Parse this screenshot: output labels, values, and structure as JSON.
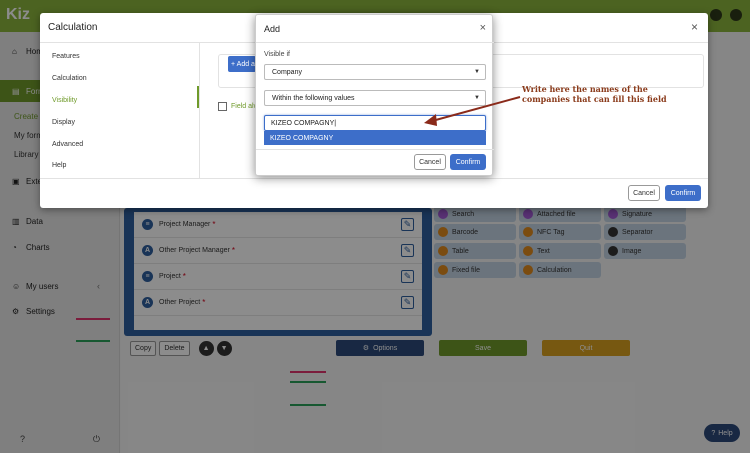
{
  "app": {
    "brand_color": "#8bb43c",
    "accent_blue": "#3d6ec9"
  },
  "sidebar": {
    "home_label": "Home",
    "forms_label": "Forms",
    "sub_items": [
      "Create a",
      "My forms",
      "Library"
    ],
    "external_label": "Exte",
    "data_label": "Data",
    "charts_label": "Charts",
    "users_label": "My users",
    "settings_label": "Settings"
  },
  "background_fields": {
    "rows": [
      {
        "icon": "≡",
        "label": "Project Manager",
        "required": "*"
      },
      {
        "icon": "A",
        "label": "Other Project Manager",
        "required": "*"
      },
      {
        "icon": "≡",
        "label": "Project",
        "required": "*"
      },
      {
        "icon": "A",
        "label": "Other Project",
        "required": "*"
      }
    ]
  },
  "palette": {
    "items": [
      {
        "label": "Search",
        "color": "#a35ad6"
      },
      {
        "label": "Attached file",
        "color": "#a35ad6"
      },
      {
        "label": "Signature",
        "color": "#a35ad6"
      },
      {
        "label": "Barcode",
        "color": "#e08a1e"
      },
      {
        "label": "NFC Tag",
        "color": "#e08a1e"
      },
      {
        "label": "Separator",
        "color": "#333333"
      },
      {
        "label": "Table",
        "color": "#e08a1e"
      },
      {
        "label": "Text",
        "color": "#e08a1e"
      },
      {
        "label": "Image",
        "color": "#333333"
      },
      {
        "label": "Fixed file",
        "color": "#e08a1e"
      },
      {
        "label": "Calculation",
        "color": "#e08a1e"
      }
    ]
  },
  "bottom_toolbar": {
    "copy_label": "Copy",
    "delete_label": "Delete",
    "options_label": "Options",
    "save_label": "Save",
    "quit_label": "Quit"
  },
  "help_fab": {
    "label": "Help"
  },
  "calc_modal": {
    "title": "Calculation",
    "close": "×",
    "nav": [
      "Features",
      "Calculation",
      "Visibility",
      "Display",
      "Advanced",
      "Help"
    ],
    "active_nav": "Visibility",
    "add_button": "+ Add a",
    "field_always": "Field alw",
    "cancel_label": "Cancel",
    "confirm_label": "Confirm"
  },
  "add_modal": {
    "title": "Add",
    "close": "×",
    "visible_if_label": "Visible if",
    "condition_field": "Company",
    "condition_operator": "Within the following values",
    "value_input": "KIZEO COMPAGNY",
    "suggestion": "KIZEO COMPAGNY",
    "cancel_label": "Cancel",
    "confirm_label": "Confirm"
  },
  "annotation": {
    "text": "Write here the names of the companies that can fill this field"
  }
}
